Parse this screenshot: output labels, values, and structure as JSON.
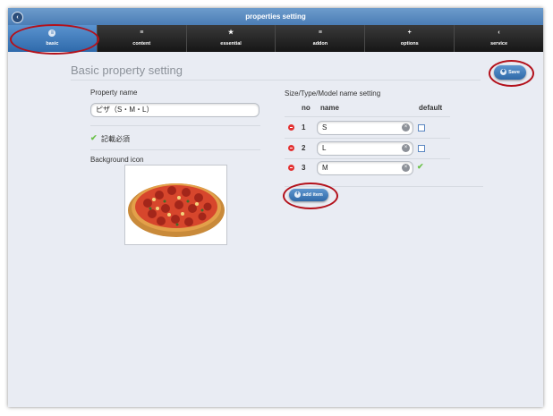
{
  "window": {
    "title": "properties setting"
  },
  "nav": {
    "tabs": [
      {
        "label": "basic",
        "icon": "list-icon"
      },
      {
        "label": "content",
        "icon": "list-icon"
      },
      {
        "label": "essential",
        "icon": "star-icon"
      },
      {
        "label": "addon",
        "icon": "list-icon"
      },
      {
        "label": "options",
        "icon": "plus-icon"
      },
      {
        "label": "service",
        "icon": "back-icon"
      }
    ],
    "active": "basic"
  },
  "page": {
    "title": "Basic property setting",
    "save_label": "Save"
  },
  "left": {
    "property_name_label": "Property name",
    "property_name_value": "ピザ（S・M・L）",
    "required_label": "記載必須",
    "bg_icon_label": "Background icon"
  },
  "right": {
    "section_title": "Size/Type/Model name setting",
    "col_no": "no",
    "col_name": "name",
    "col_default": "default",
    "rows": [
      {
        "no": "1",
        "name": "S",
        "default": false
      },
      {
        "no": "2",
        "name": "L",
        "default": false
      },
      {
        "no": "3",
        "name": "M",
        "default": true
      }
    ],
    "add_label": "add item"
  },
  "colors": {
    "accent": "#2f69a8",
    "highlight_ring": "#b3111b",
    "check": "#6cc24a",
    "remove": "#e33232"
  }
}
